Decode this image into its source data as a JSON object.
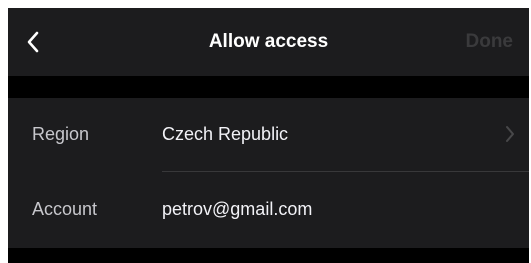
{
  "nav": {
    "back_icon": "chevron-left-icon",
    "title": "Allow access",
    "done_label": "Done"
  },
  "rows": [
    {
      "label": "Region",
      "value": "Czech Republic",
      "icon": "chevron-right-icon"
    },
    {
      "label": "Account",
      "value": "petrov@gmail.com"
    }
  ],
  "colors": {
    "background": "#000000",
    "surface": "#1c1c1e",
    "text_primary": "#ffffff",
    "text_secondary": "#c7c7cc",
    "done_disabled": "#3a3a3c",
    "chevron": "#48484a",
    "separator": "#38383a"
  }
}
